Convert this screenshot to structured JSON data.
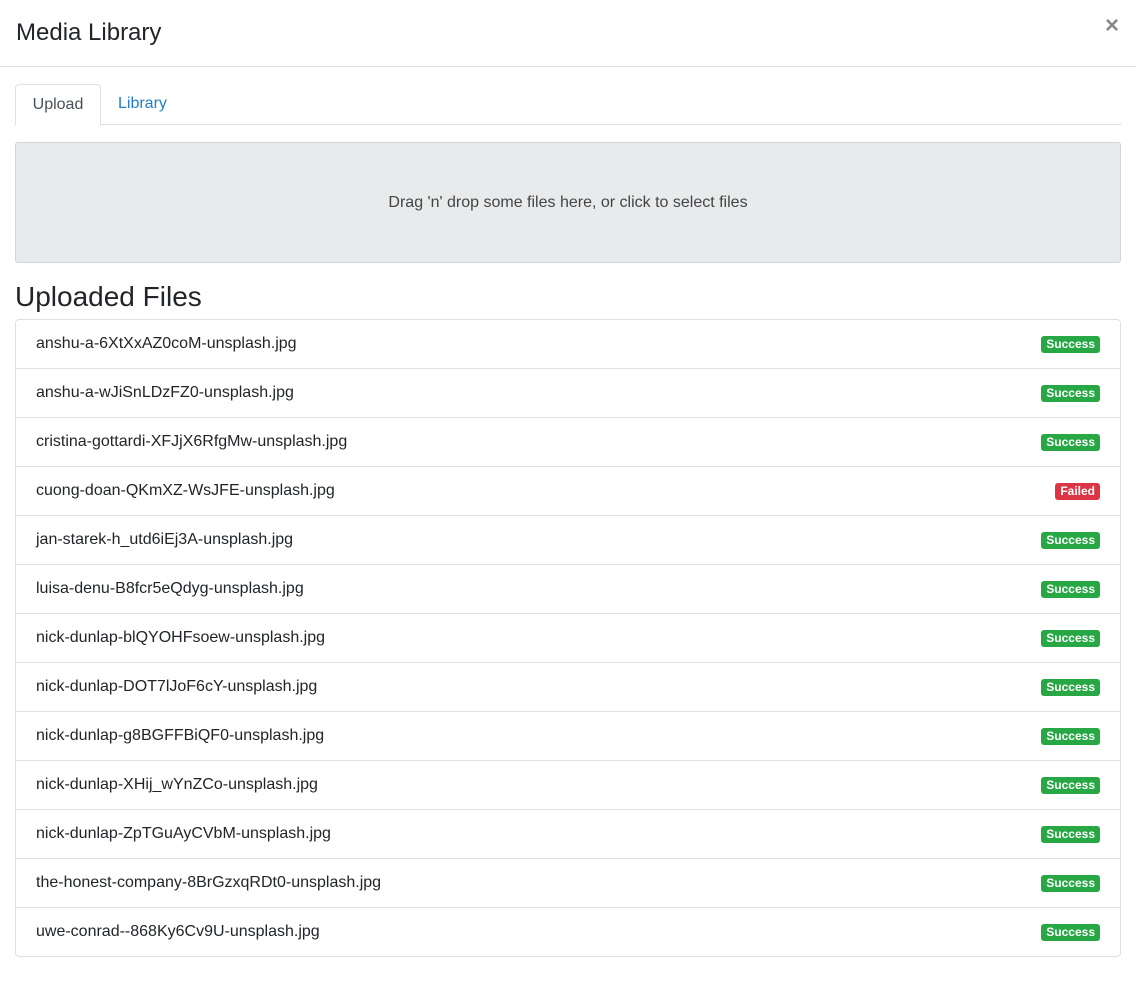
{
  "modal": {
    "title": "Media Library",
    "close_label": "×"
  },
  "tabs": [
    {
      "label": "Upload",
      "active": true
    },
    {
      "label": "Library",
      "active": false
    }
  ],
  "dropzone": {
    "text": "Drag 'n' drop some files here, or click to select files"
  },
  "uploaded": {
    "title": "Uploaded Files",
    "files": [
      {
        "name": "anshu-a-6XtXxAZ0coM-unsplash.jpg",
        "status": "Success"
      },
      {
        "name": "anshu-a-wJiSnLDzFZ0-unsplash.jpg",
        "status": "Success"
      },
      {
        "name": "cristina-gottardi-XFJjX6RfgMw-unsplash.jpg",
        "status": "Success"
      },
      {
        "name": "cuong-doan-QKmXZ-WsJFE-unsplash.jpg",
        "status": "Failed"
      },
      {
        "name": "jan-starek-h_utd6iEj3A-unsplash.jpg",
        "status": "Success"
      },
      {
        "name": "luisa-denu-B8fcr5eQdyg-unsplash.jpg",
        "status": "Success"
      },
      {
        "name": "nick-dunlap-blQYOHFsoew-unsplash.jpg",
        "status": "Success"
      },
      {
        "name": "nick-dunlap-DOT7lJoF6cY-unsplash.jpg",
        "status": "Success"
      },
      {
        "name": "nick-dunlap-g8BGFFBiQF0-unsplash.jpg",
        "status": "Success"
      },
      {
        "name": "nick-dunlap-XHij_wYnZCo-unsplash.jpg",
        "status": "Success"
      },
      {
        "name": "nick-dunlap-ZpTGuAyCVbM-unsplash.jpg",
        "status": "Success"
      },
      {
        "name": "the-honest-company-8BrGzxqRDt0-unsplash.jpg",
        "status": "Success"
      },
      {
        "name": "uwe-conrad--868Ky6Cv9U-unsplash.jpg",
        "status": "Success"
      }
    ]
  },
  "colors": {
    "success": "#28a745",
    "failed": "#dc3545",
    "link": "#1f7fc8"
  }
}
